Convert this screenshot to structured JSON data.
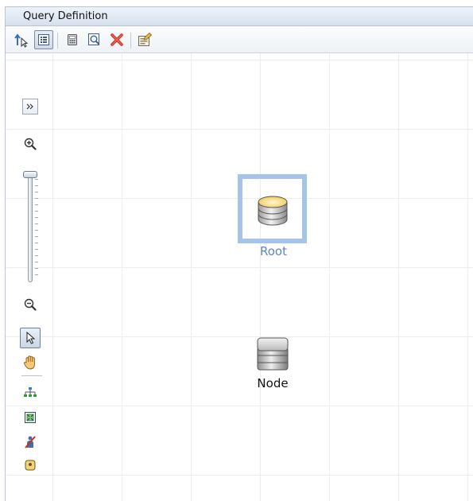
{
  "panel": {
    "title": "Query Definition"
  },
  "toolbar": {
    "buttons": [
      {
        "name": "move-up",
        "icon": "arrow-up-cursor-icon",
        "tooltip": ""
      },
      {
        "name": "properties-list",
        "icon": "list-properties-icon",
        "tooltip": "",
        "pressed": true
      },
      {
        "name": "calculator",
        "icon": "calculator-icon",
        "tooltip": ""
      },
      {
        "name": "preview",
        "icon": "magnifier-preview-icon",
        "tooltip": ""
      },
      {
        "name": "delete",
        "icon": "red-x-delete-icon",
        "tooltip": ""
      },
      {
        "name": "edit-properties",
        "icon": "edit-properties-icon",
        "tooltip": ""
      }
    ]
  },
  "palette": {
    "tools": [
      {
        "name": "expand",
        "icon": "double-chevron-right-icon"
      },
      {
        "name": "zoom-in",
        "icon": "zoom-in-icon"
      },
      {
        "name": "zoom-slider",
        "icon": "zoom-slider",
        "level": 1.0
      },
      {
        "name": "zoom-out",
        "icon": "zoom-out-icon"
      },
      {
        "name": "select",
        "icon": "pointer-arrow-icon",
        "selected": true
      },
      {
        "name": "pan",
        "icon": "hand-pan-icon"
      },
      {
        "name": "hierarchy-layout",
        "icon": "hierarchy-icon"
      },
      {
        "name": "fit-to-window",
        "icon": "fit-window-icon"
      },
      {
        "name": "hide-node",
        "icon": "person-strike-icon"
      },
      {
        "name": "more",
        "icon": "user-badge-icon"
      }
    ]
  },
  "canvas": {
    "nodes": [
      {
        "id": "root",
        "label": "Root",
        "selected": true,
        "icon": "database-yellow-icon",
        "label_color": "#5b84c4"
      },
      {
        "id": "node",
        "label": "Node",
        "selected": false,
        "icon": "database-gray-icon",
        "label_color": "#111111"
      }
    ]
  },
  "colors": {
    "selection": "#a6c3e8",
    "grid": "#ececec",
    "titlebar": "#dbe5f0"
  }
}
